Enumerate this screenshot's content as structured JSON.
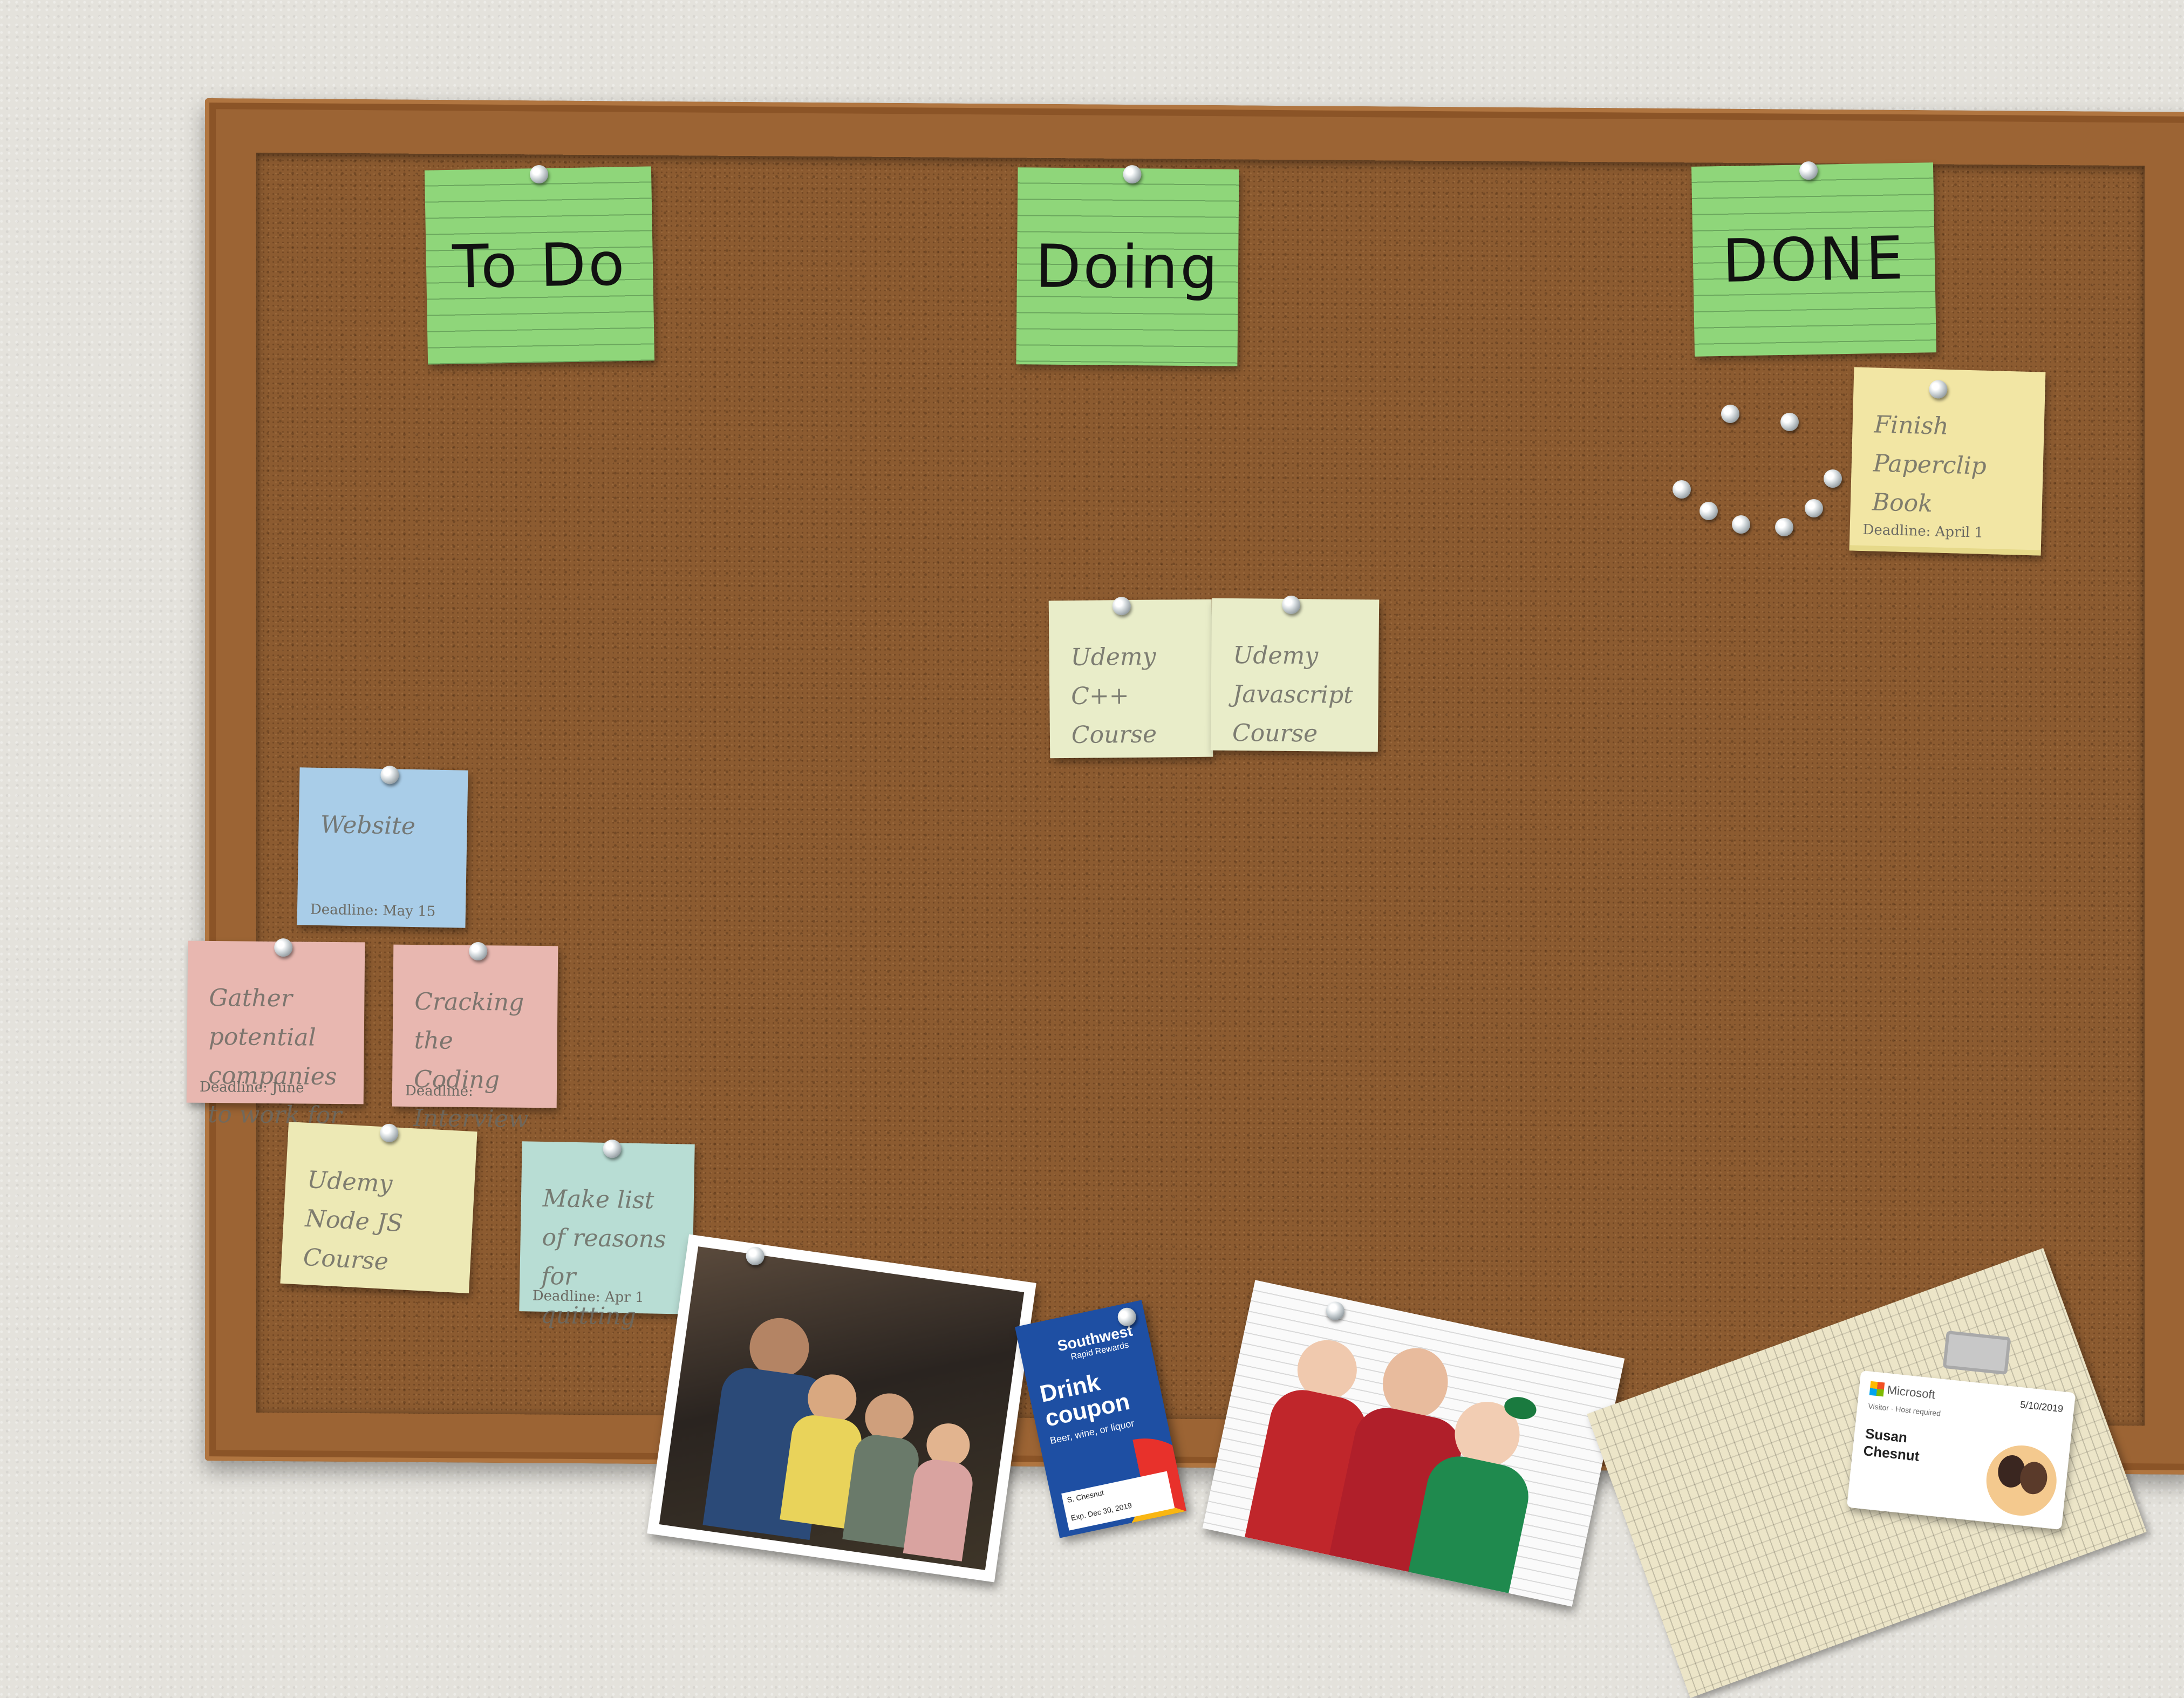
{
  "board": {
    "columns": [
      {
        "label": "To Do"
      },
      {
        "label": "Doing"
      },
      {
        "label": "DONE"
      }
    ]
  },
  "notes": {
    "done_1": {
      "text": "Finish Paperclip Book",
      "deadline": "Deadline: April 1"
    },
    "doing_1": {
      "text": "Udemy C++ Course"
    },
    "doing_2": {
      "text": "Udemy Javascript Course"
    },
    "todo_website": {
      "text": "Website",
      "deadline": "Deadline: May 15"
    },
    "todo_companies": {
      "text": "Gather potential companies to work for",
      "deadline": "Deadline: June"
    },
    "todo_coding_book": {
      "text": "Cracking the Coding Interview Book",
      "deadline": "Deadline:"
    },
    "todo_udemy_node": {
      "text": "Udemy Node JS Course"
    },
    "todo_list": {
      "text": "Make list of reasons for quitting",
      "deadline": "Deadline: Apr 1"
    }
  },
  "coupon": {
    "brand": "Southwest",
    "subbrand": "Rapid Rewards",
    "title": "Drink coupon",
    "subtitle": "Beer, wine, or liquor",
    "holder": "S. Chesnut",
    "expiry": "Exp. Dec 30, 2019"
  },
  "visitor_badge": {
    "company": "Microsoft",
    "date": "5/10/2019",
    "type": "Visitor - Host required",
    "name_line1": "Susan",
    "name_line2": "Chesnut"
  },
  "colors": {
    "header_green": "#8fd67a",
    "yellow_note": "#f2e6a4",
    "pale_note": "#e9edc9",
    "blue_note": "#a9cde8",
    "pink_note": "#e8b7b0",
    "teal_note": "#b8ddd4",
    "cream_note": "#ede9b5",
    "southwest_blue": "#1e4fa3"
  }
}
